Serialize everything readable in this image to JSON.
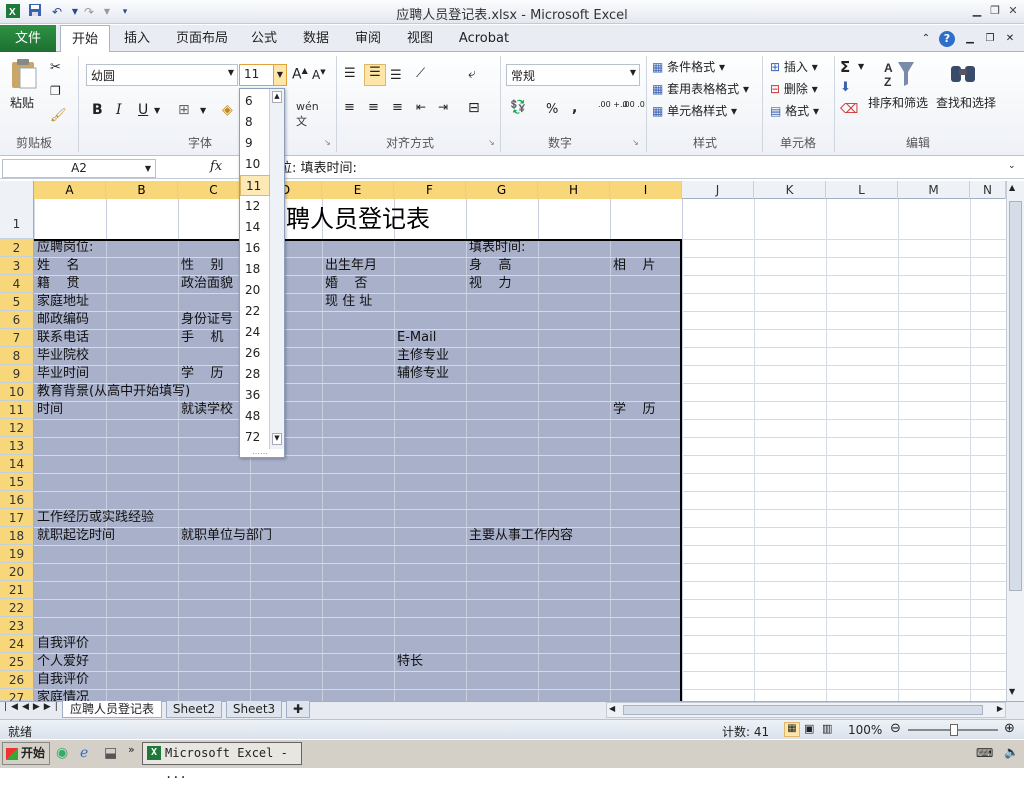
{
  "window": {
    "title": "应聘人员登记表.xlsx  -  Microsoft Excel"
  },
  "ribbon": {
    "file_tab": "文件",
    "tabs": [
      "开始",
      "插入",
      "页面布局",
      "公式",
      "数据",
      "审阅",
      "视图",
      "Acrobat"
    ],
    "groups": [
      "剪贴板",
      "字体",
      "对齐方式",
      "数字",
      "样式",
      "单元格",
      "编辑"
    ],
    "paste_label": "粘贴",
    "font_name": "幼圆",
    "font_size": "11",
    "number_format": "常规",
    "styles": [
      "条件格式",
      "套用表格格式",
      "单元格样式"
    ],
    "cells_buttons": [
      "插入",
      "删除",
      "格式"
    ],
    "edit_buttons": [
      "排序和筛选",
      "查找和选择"
    ],
    "percent": "%",
    "comma": ",",
    "inc_decimal": ".00 +.0",
    "dec_decimal": ".00 .0",
    "sum_icon": "Σ"
  },
  "font_size_list": [
    "6",
    "8",
    "9",
    "10",
    "11",
    "12",
    "14",
    "16",
    "18",
    "20",
    "22",
    "24",
    "26",
    "28",
    "36",
    "48",
    "72"
  ],
  "formula": {
    "namebox": "A2",
    "fx": "fx",
    "text": "应聘岗位:                                                    填表时间:"
  },
  "columns": [
    "A",
    "B",
    "C",
    "D",
    "E",
    "F",
    "G",
    "H",
    "I",
    "J",
    "K",
    "L",
    "M",
    "N"
  ],
  "rows": [
    "1",
    "2",
    "3",
    "4",
    "5",
    "6",
    "7",
    "8",
    "9",
    "10",
    "11",
    "12",
    "13",
    "14",
    "15",
    "16",
    "17",
    "18",
    "19",
    "20",
    "21",
    "22",
    "23",
    "24",
    "25",
    "26",
    "27"
  ],
  "sheet": {
    "title": "应聘人员登记表",
    "title_visible": "聘人员登记表",
    "cells": [
      {
        "r": 2,
        "c": "A",
        "t": "应聘岗位:"
      },
      {
        "r": 2,
        "c": "G",
        "t": "填表时间:"
      },
      {
        "r": 3,
        "c": "A",
        "t": "姓    名"
      },
      {
        "r": 3,
        "c": "C",
        "t": "性    别"
      },
      {
        "r": 3,
        "c": "E",
        "t": "出生年月"
      },
      {
        "r": 3,
        "c": "G",
        "t": "身    高"
      },
      {
        "r": 3,
        "c": "I",
        "t": "相    片"
      },
      {
        "r": 4,
        "c": "A",
        "t": "籍    贯"
      },
      {
        "r": 4,
        "c": "C",
        "t": "政治面貌"
      },
      {
        "r": 4,
        "c": "E",
        "t": "婚    否"
      },
      {
        "r": 4,
        "c": "G",
        "t": "视    力"
      },
      {
        "r": 5,
        "c": "A",
        "t": "家庭地址"
      },
      {
        "r": 5,
        "c": "E",
        "t": "现 住 址"
      },
      {
        "r": 6,
        "c": "A",
        "t": "邮政编码"
      },
      {
        "r": 6,
        "c": "C",
        "t": "身份证号"
      },
      {
        "r": 7,
        "c": "A",
        "t": "联系电话"
      },
      {
        "r": 7,
        "c": "C",
        "t": "手    机"
      },
      {
        "r": 7,
        "c": "F",
        "t": "E-Mail"
      },
      {
        "r": 8,
        "c": "A",
        "t": "毕业院校"
      },
      {
        "r": 8,
        "c": "F",
        "t": "主修专业"
      },
      {
        "r": 9,
        "c": "A",
        "t": "毕业时间"
      },
      {
        "r": 9,
        "c": "C",
        "t": "学    历"
      },
      {
        "r": 9,
        "c": "F",
        "t": "辅修专业"
      },
      {
        "r": 10,
        "c": "A",
        "t": "教育背景(从高中开始填写)"
      },
      {
        "r": 11,
        "c": "A",
        "t": "时间"
      },
      {
        "r": 11,
        "c": "C",
        "t": "就读学校"
      },
      {
        "r": 11,
        "c": "I",
        "t": "学    历"
      },
      {
        "r": 17,
        "c": "A",
        "t": "工作经历或实践经验"
      },
      {
        "r": 18,
        "c": "A",
        "t": "就职起讫时间"
      },
      {
        "r": 18,
        "c": "C",
        "t": "就职单位与部门"
      },
      {
        "r": 18,
        "c": "G",
        "t": "主要从事工作内容"
      },
      {
        "r": 24,
        "c": "A",
        "t": "自我评价"
      },
      {
        "r": 25,
        "c": "A",
        "t": "个人爱好"
      },
      {
        "r": 25,
        "c": "F",
        "t": "特长"
      },
      {
        "r": 26,
        "c": "A",
        "t": "自我评价"
      },
      {
        "r": 27,
        "c": "A",
        "t": "家庭情况"
      }
    ]
  },
  "sheet_tabs": [
    "应聘人员登记表",
    "Sheet2",
    "Sheet3"
  ],
  "status": {
    "ready": "就绪",
    "count": "计数: 41",
    "zoom": "100%"
  },
  "taskbar": {
    "start": "开始",
    "item": "Microsoft Excel - ..."
  },
  "colors": {
    "selection_fill": "#a9b0ca",
    "header_highlight": "#f8d77a",
    "file_tab": "#2e9142"
  }
}
